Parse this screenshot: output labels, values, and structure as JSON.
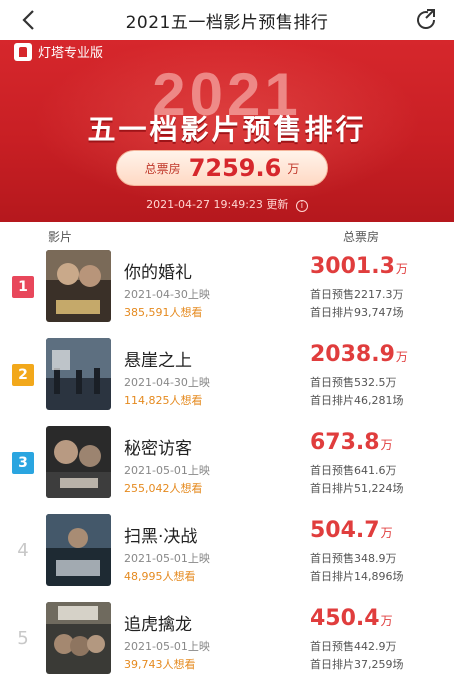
{
  "topbar": {
    "back_icon": "chevron-left-icon",
    "title": "2021五一档影片预售排行",
    "share_icon": "share-icon"
  },
  "banner": {
    "brand": "灯塔专业版",
    "year": "2021",
    "headline": "五一档影片预售排行",
    "total_label": "总票房",
    "total_value": "7259.6",
    "total_unit": "万",
    "updated": "2021-04-27 19:49:23 更新",
    "info_icon": "ⓘ"
  },
  "columns": {
    "film": "影片",
    "box_office": "总票房"
  },
  "colors": {
    "brand_red": "#d6272c",
    "rank1": "#e8475b",
    "rank2": "#f2a81b",
    "rank3": "#2aa5e0",
    "want_orange": "#e58a1f"
  },
  "movies": [
    {
      "rank": "1",
      "name": "你的婚礼",
      "date": "2021-04-30上映",
      "want": "385,591人想看",
      "box": "3001.3",
      "unit": "万",
      "presale": "首日预售2217.3万",
      "shows": "首日排片93,747场"
    },
    {
      "rank": "2",
      "name": "悬崖之上",
      "date": "2021-04-30上映",
      "want": "114,825人想看",
      "box": "2038.9",
      "unit": "万",
      "presale": "首日预售532.5万",
      "shows": "首日排片46,281场"
    },
    {
      "rank": "3",
      "name": "秘密访客",
      "date": "2021-05-01上映",
      "want": "255,042人想看",
      "box": "673.8",
      "unit": "万",
      "presale": "首日预售641.6万",
      "shows": "首日排片51,224场"
    },
    {
      "rank": "4",
      "name": "扫黑·决战",
      "date": "2021-05-01上映",
      "want": "48,995人想看",
      "box": "504.7",
      "unit": "万",
      "presale": "首日预售348.9万",
      "shows": "首日排片14,896场"
    },
    {
      "rank": "5",
      "name": "追虎擒龙",
      "date": "2021-05-01上映",
      "want": "39,743人想看",
      "box": "450.4",
      "unit": "万",
      "presale": "首日预售442.9万",
      "shows": "首日排片37,259场"
    }
  ]
}
